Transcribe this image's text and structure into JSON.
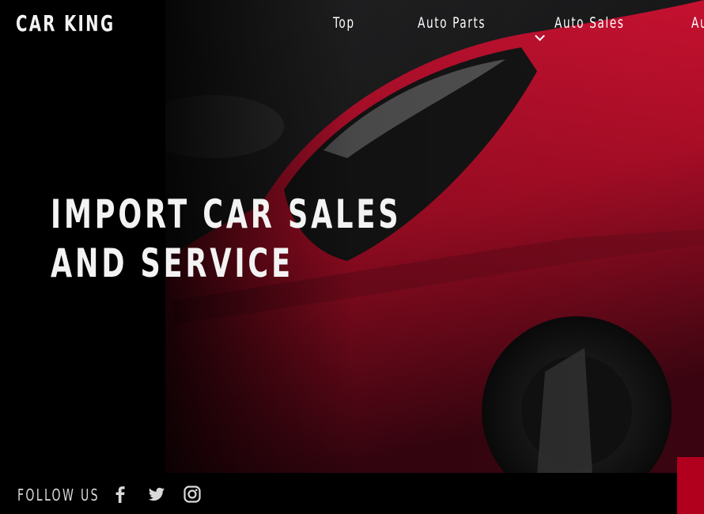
{
  "brand": {
    "name": "CAR KING"
  },
  "nav": {
    "items": [
      "Top",
      "Auto Parts",
      "Auto Sales",
      "Au"
    ]
  },
  "hero": {
    "headline_line1": "IMPORT CAR SALES",
    "headline_line2": "AND SERVICE"
  },
  "footer": {
    "follow_label": "FOLLOW US",
    "social_icons": [
      "facebook-icon",
      "twitter-icon",
      "instagram-icon"
    ]
  },
  "colors": {
    "accent_red": "#b0001e",
    "car_red": "#c8102e",
    "background": "#000000"
  }
}
